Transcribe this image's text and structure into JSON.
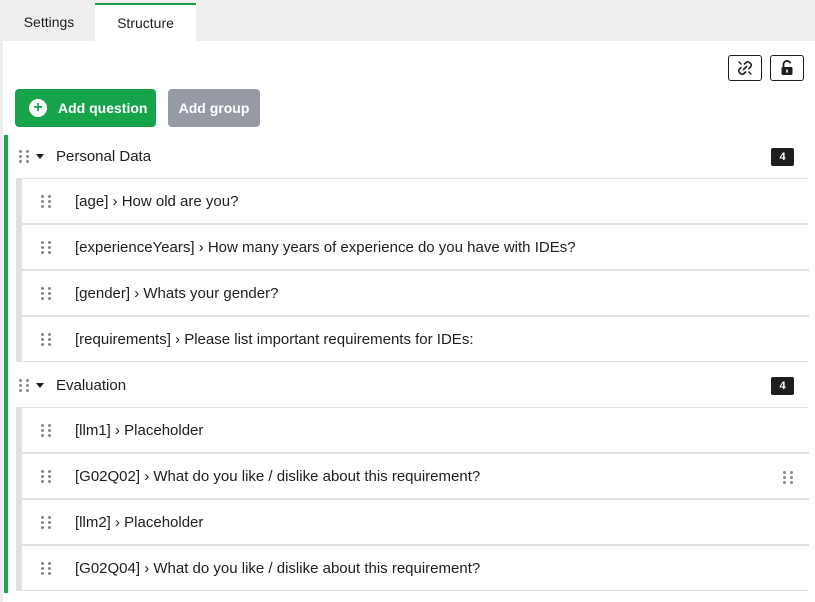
{
  "tabs": [
    {
      "label": "Settings",
      "active": false
    },
    {
      "label": "Structure",
      "active": true
    }
  ],
  "toolbar": {
    "link_icon": "link-icon",
    "lock_icon": "unlock-icon",
    "add_question_label": "Add question",
    "add_group_label": "Add group"
  },
  "colors": {
    "primary": "#16a34a",
    "accent": "#1fa84f",
    "disabled": "#969aa4",
    "badge": "#1e1e1e"
  },
  "groups": [
    {
      "title": "Personal Data",
      "count": "4",
      "questions": [
        {
          "text": "[age] › How old are you?"
        },
        {
          "text": "[experienceYears] › How many years of experience do you have with IDEs?"
        },
        {
          "text": "[gender] › Whats your gender?"
        },
        {
          "text": "[requirements] › Please list important requirements for IDEs:"
        }
      ]
    },
    {
      "title": "Evaluation",
      "count": "4",
      "questions": [
        {
          "text": "[llm1] › Placeholder"
        },
        {
          "text": "[G02Q02] › What do you like / dislike about this requirement?"
        },
        {
          "text": "[llm2] › Placeholder"
        },
        {
          "text": "[G02Q04] › What do you like / dislike about this requirement?"
        }
      ]
    }
  ]
}
